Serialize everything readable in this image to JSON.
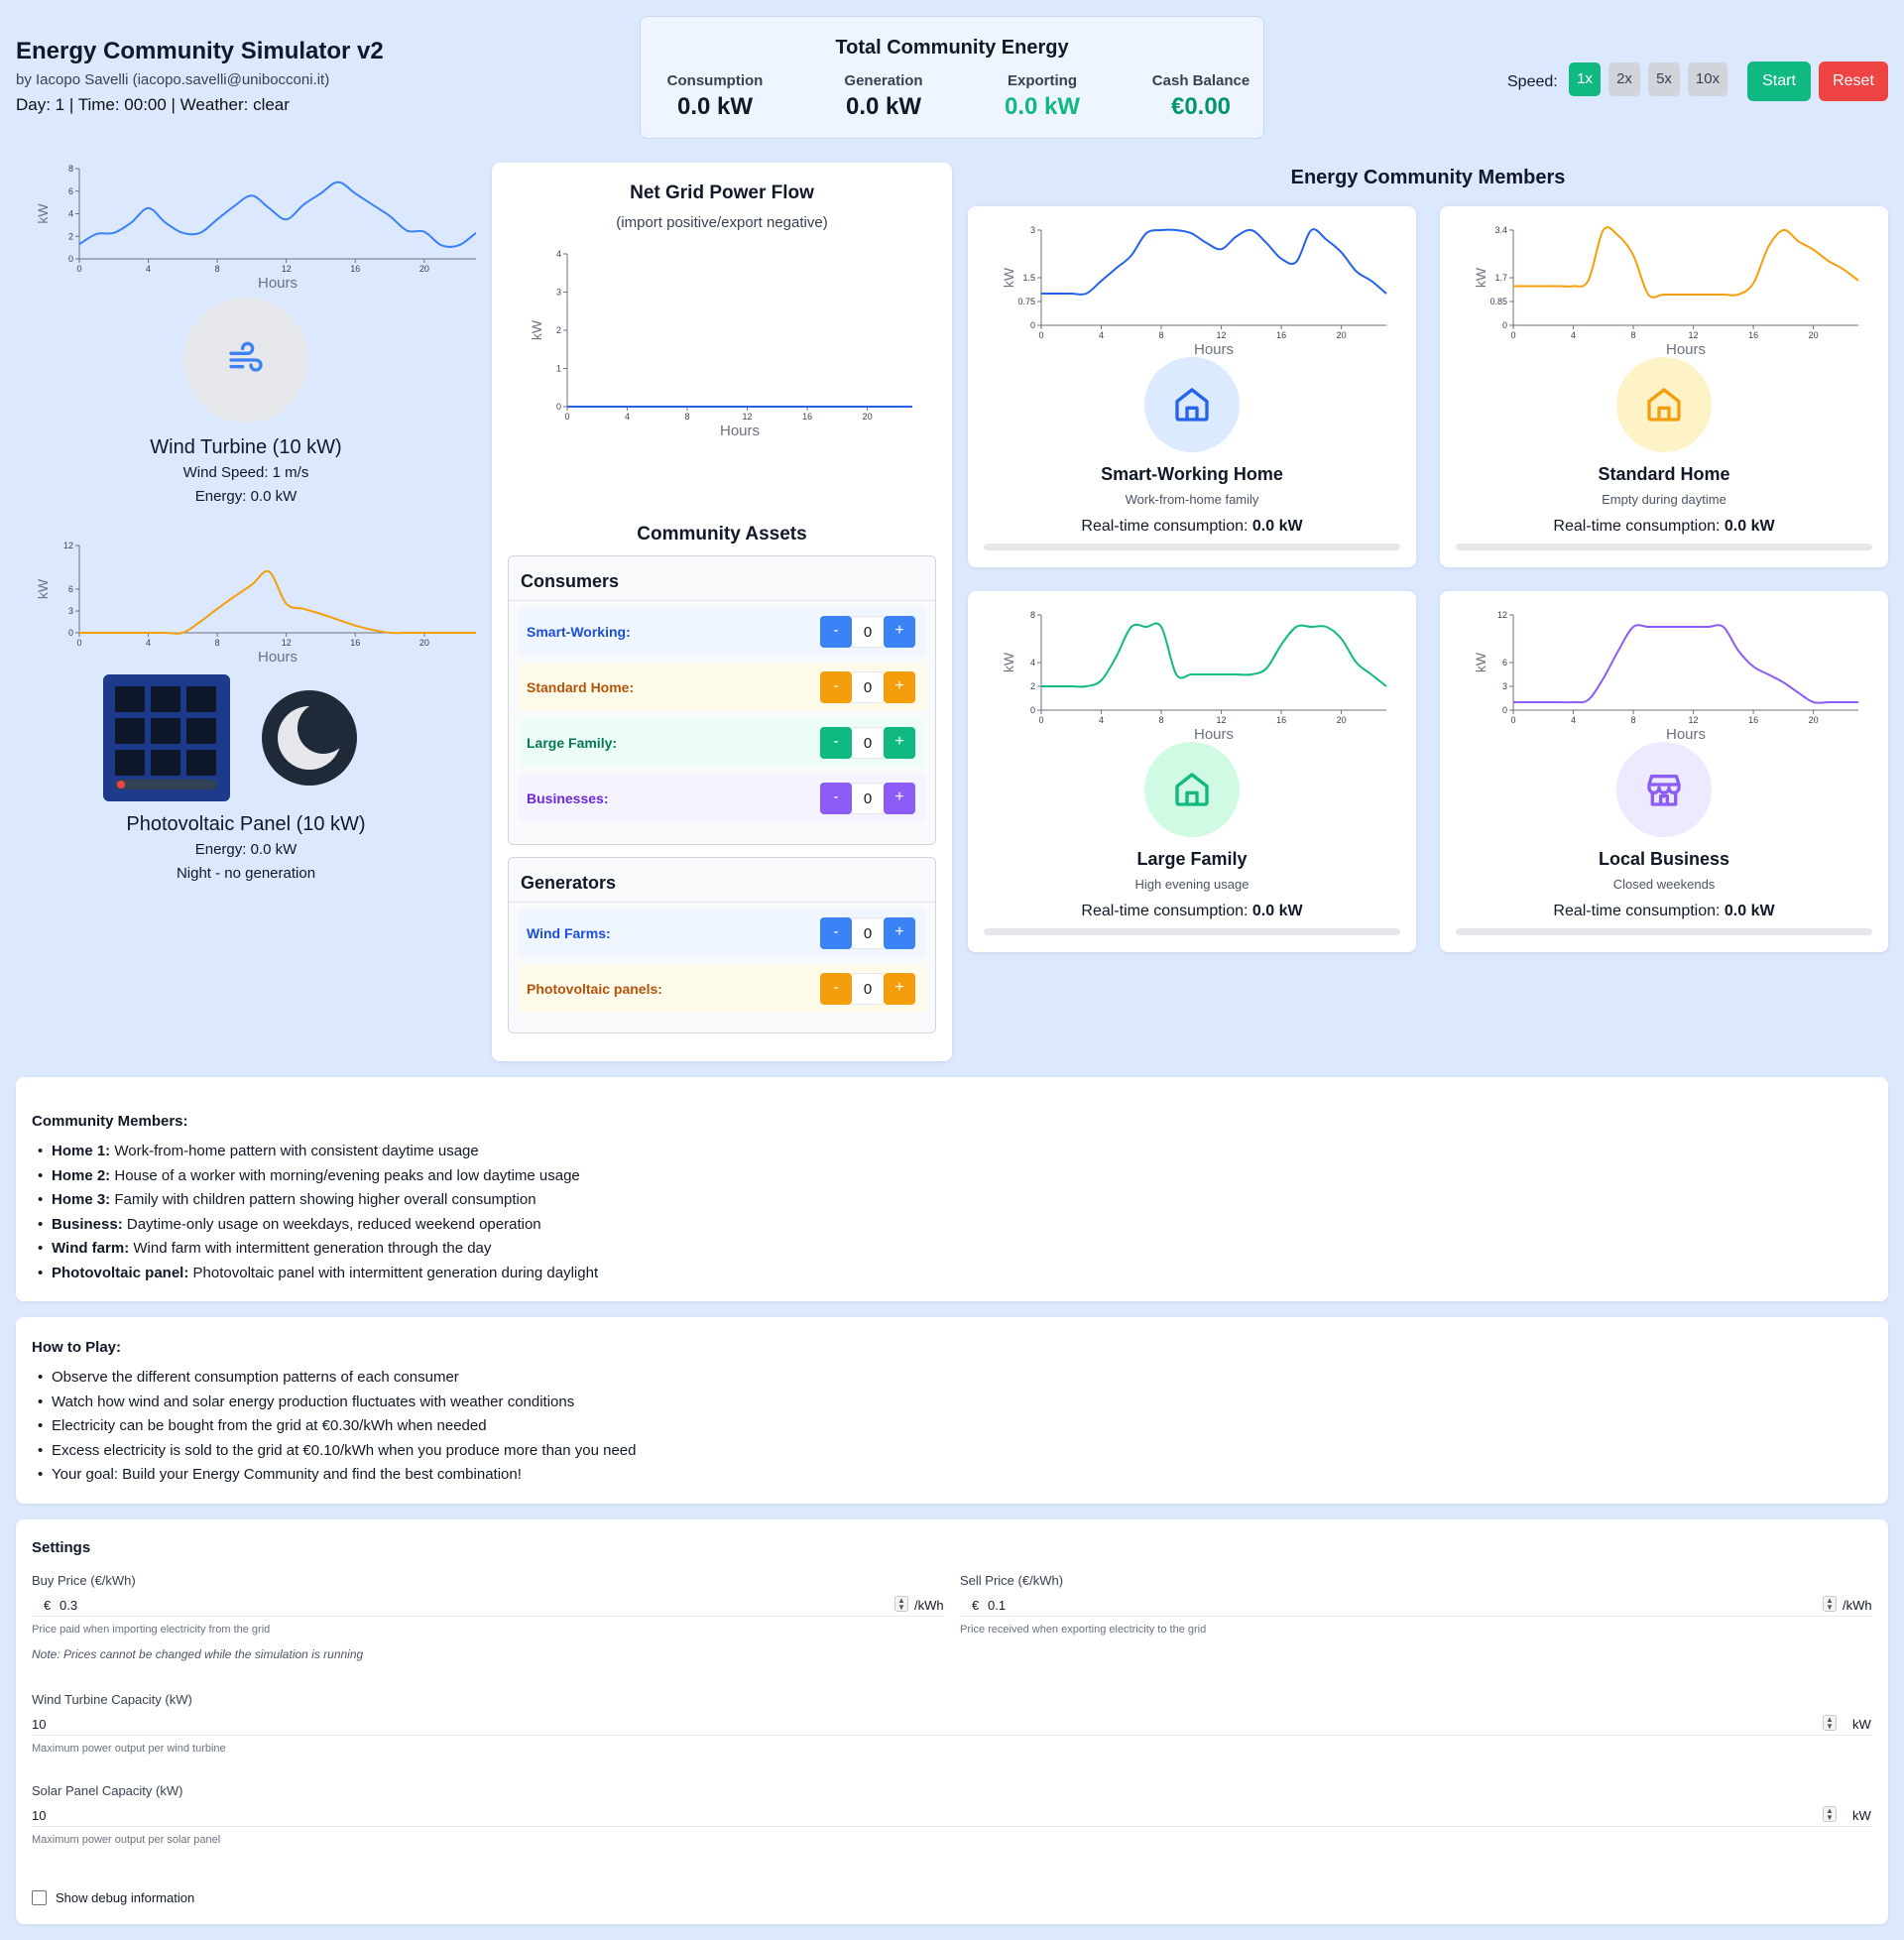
{
  "header": {
    "title": "Energy Community Simulator v2",
    "author": "by Iacopo Savelli (iacopo.savelli@unibocconi.it)",
    "status": "Day: 1 | Time: 00:00 | Weather: clear"
  },
  "totals": {
    "title": "Total Community Energy",
    "consumption_label": "Consumption",
    "consumption_value": "0.0 kW",
    "generation_label": "Generation",
    "generation_value": "0.0 kW",
    "exporting_label": "Exporting",
    "exporting_value": "0.0 kW",
    "cash_label": "Cash Balance",
    "cash_value": "€0.00"
  },
  "controls": {
    "speed_label": "Speed:",
    "speeds": [
      "1x",
      "2x",
      "5x",
      "10x"
    ],
    "active_speed": "1x",
    "start_label": "Start",
    "reset_label": "Reset"
  },
  "wind": {
    "title": "Wind Turbine (10 kW)",
    "speed": "Wind Speed: 1 m/s",
    "energy": "Energy: 0.0 kW",
    "icon": "wind-icon",
    "chart_data": {
      "type": "line",
      "ylabel": "kW",
      "xlabel": "Hours",
      "xlim": [
        0,
        23
      ],
      "ylim": [
        0,
        8
      ],
      "xticks": [
        0,
        4,
        8,
        12,
        16,
        20
      ],
      "yticks": [
        0,
        2,
        4,
        6,
        8
      ],
      "color": "#3b82f6",
      "x": [
        0,
        1,
        2,
        3,
        4,
        5,
        6,
        7,
        8,
        9,
        10,
        11,
        12,
        13,
        14,
        15,
        16,
        17,
        18,
        19,
        20,
        21,
        22,
        23
      ],
      "y": [
        1.3,
        2.2,
        2.3,
        3.2,
        4.5,
        3.2,
        2.3,
        2.3,
        3.5,
        4.7,
        5.6,
        4.5,
        3.5,
        4.8,
        5.8,
        6.8,
        5.8,
        4.8,
        3.8,
        2.5,
        2.4,
        1.2,
        1.2,
        2.3
      ]
    }
  },
  "solar": {
    "title": "Photovoltaic Panel (10 kW)",
    "energy": "Energy: 0.0 kW",
    "note": "Night - no generation",
    "icon": "moon-icon",
    "chart_data": {
      "type": "line",
      "ylabel": "kW",
      "xlabel": "Hours",
      "xlim": [
        0,
        23
      ],
      "ylim": [
        0,
        12
      ],
      "xticks": [
        0,
        4,
        8,
        12,
        16,
        20
      ],
      "yticks": [
        0,
        3,
        6,
        12
      ],
      "color": "#f59e0b",
      "x": [
        0,
        1,
        2,
        3,
        4,
        5,
        6,
        7,
        8,
        9,
        10,
        11,
        12,
        13,
        14,
        15,
        16,
        17,
        18,
        19,
        20,
        21,
        22,
        23
      ],
      "y": [
        0,
        0,
        0,
        0,
        0,
        0,
        0,
        1.5,
        3.3,
        5,
        6.6,
        8.4,
        4,
        3.3,
        2.6,
        1.8,
        1,
        0.4,
        0,
        0,
        0,
        0,
        0,
        0
      ]
    }
  },
  "grid": {
    "title": "Net Grid Power Flow",
    "subtitle": "(import positive/export negative)",
    "chart_data": {
      "type": "line",
      "ylabel": "kW",
      "xlabel": "Hours",
      "xlim": [
        0,
        23
      ],
      "ylim": [
        0,
        4
      ],
      "xticks": [
        0,
        4,
        8,
        12,
        16,
        20
      ],
      "yticks": [
        0,
        1,
        2,
        3,
        4
      ],
      "color": "#2563eb",
      "x": [
        0,
        23
      ],
      "y": [
        0,
        0
      ]
    }
  },
  "assets": {
    "title": "Community Assets",
    "consumers_title": "Consumers",
    "consumers": [
      {
        "label": "Smart-Working:",
        "count": "0",
        "color": "#3b82f6",
        "bg": "#eff6ff",
        "text": "#1d4ed8"
      },
      {
        "label": "Standard Home:",
        "count": "0",
        "color": "#f59e0b",
        "bg": "#fffbeb",
        "text": "#b45309"
      },
      {
        "label": "Large Family:",
        "count": "0",
        "color": "#10b981",
        "bg": "#ecfdf5",
        "text": "#047857"
      },
      {
        "label": "Businesses:",
        "count": "0",
        "color": "#8b5cf6",
        "bg": "#f5f3ff",
        "text": "#6d28d9"
      }
    ],
    "generators_title": "Generators",
    "generators": [
      {
        "label": "Wind Farms:",
        "count": "0",
        "color": "#3b82f6",
        "bg": "#eff6ff",
        "text": "#1d4ed8"
      },
      {
        "label": "Photovoltaic panels:",
        "count": "0",
        "color": "#f59e0b",
        "bg": "#fffbeb",
        "text": "#b45309"
      }
    ],
    "minus": "-",
    "plus": "+"
  },
  "members": {
    "title": "Energy Community Members",
    "rt_label": "Real-time consumption: ",
    "cards": [
      {
        "name": "Smart-Working Home",
        "desc": "Work-from-home family",
        "value": "0.0 kW",
        "color": "#2563eb",
        "circle": "#dbeafe",
        "icon": "home-icon",
        "chart_data": {
          "type": "line",
          "ylabel": "kW",
          "xlabel": "Hours",
          "xlim": [
            0,
            23
          ],
          "ylim": [
            0,
            3
          ],
          "xticks": [
            0,
            4,
            8,
            12,
            16,
            20
          ],
          "yticks": [
            0,
            0.75,
            1.5,
            3
          ],
          "x": [
            0,
            1,
            2,
            3,
            4,
            5,
            6,
            7,
            8,
            9,
            10,
            11,
            12,
            13,
            14,
            15,
            16,
            17,
            18,
            19,
            20,
            21,
            22,
            23
          ],
          "y": [
            1,
            1,
            1,
            1,
            1.4,
            1.8,
            2.2,
            2.9,
            3,
            3,
            2.9,
            2.6,
            2.4,
            2.8,
            3.0,
            2.6,
            2.1,
            2.0,
            3.0,
            2.7,
            2.3,
            1.7,
            1.4,
            1.0
          ]
        }
      },
      {
        "name": "Standard Home",
        "desc": "Empty during daytime",
        "value": "0.0 kW",
        "color": "#f59e0b",
        "circle": "#fef3c7",
        "icon": "home-icon",
        "chart_data": {
          "type": "line",
          "ylabel": "kW",
          "xlabel": "Hours",
          "xlim": [
            0,
            23
          ],
          "ylim": [
            0,
            3.4
          ],
          "xticks": [
            0,
            4,
            8,
            12,
            16,
            20
          ],
          "yticks": [
            0,
            0.85,
            1.7,
            3.4
          ],
          "x": [
            0,
            1,
            2,
            3,
            4,
            5,
            6,
            7,
            8,
            9,
            10,
            11,
            12,
            13,
            14,
            15,
            16,
            17,
            18,
            19,
            20,
            21,
            22,
            23
          ],
          "y": [
            1.4,
            1.4,
            1.4,
            1.4,
            1.4,
            1.6,
            3.4,
            3.2,
            2.5,
            1.1,
            1.1,
            1.1,
            1.1,
            1.1,
            1.1,
            1.1,
            1.5,
            2.8,
            3.4,
            3.0,
            2.7,
            2.3,
            2.0,
            1.6
          ]
        }
      },
      {
        "name": "Large Family",
        "desc": "High evening usage",
        "value": "0.0 kW",
        "color": "#10b981",
        "circle": "#d1fae5",
        "icon": "home-icon",
        "chart_data": {
          "type": "line",
          "ylabel": "kW",
          "xlabel": "Hours",
          "xlim": [
            0,
            23
          ],
          "ylim": [
            0,
            8
          ],
          "xticks": [
            0,
            4,
            8,
            12,
            16,
            20
          ],
          "yticks": [
            0,
            2,
            4,
            8
          ],
          "x": [
            0,
            1,
            2,
            3,
            4,
            5,
            6,
            7,
            8,
            9,
            10,
            11,
            12,
            13,
            14,
            15,
            16,
            17,
            18,
            19,
            20,
            21,
            22,
            23
          ],
          "y": [
            2,
            2,
            2,
            2,
            2.5,
            4.5,
            7,
            7,
            7,
            3,
            3,
            3,
            3,
            3,
            3,
            3.5,
            5.5,
            7,
            7,
            7,
            6,
            4,
            3,
            2
          ]
        }
      },
      {
        "name": "Local Business",
        "desc": "Closed weekends",
        "value": "0.0 kW",
        "color": "#8b5cf6",
        "circle": "#ede9fe",
        "icon": "store-icon",
        "chart_data": {
          "type": "line",
          "ylabel": "kW",
          "xlabel": "Hours",
          "xlim": [
            0,
            23
          ],
          "ylim": [
            0,
            12
          ],
          "xticks": [
            0,
            4,
            8,
            12,
            16,
            20
          ],
          "yticks": [
            0,
            3,
            6,
            12
          ],
          "x": [
            0,
            1,
            2,
            3,
            4,
            5,
            6,
            7,
            8,
            9,
            10,
            11,
            12,
            13,
            14,
            15,
            16,
            17,
            18,
            19,
            20,
            21,
            22,
            23
          ],
          "y": [
            1,
            1,
            1,
            1,
            1,
            1.3,
            4,
            7.5,
            10.5,
            10.5,
            10.5,
            10.5,
            10.5,
            10.5,
            10.5,
            7.5,
            5.5,
            4.5,
            3.5,
            2.2,
            1,
            1,
            1,
            1
          ]
        }
      }
    ]
  },
  "info_members": {
    "title": "Community Members:",
    "items": [
      {
        "b": "Home 1:",
        "t": " Work-from-home pattern with consistent daytime usage"
      },
      {
        "b": "Home 2:",
        "t": " House of a worker with morning/evening peaks and low daytime usage"
      },
      {
        "b": "Home 3:",
        "t": " Family with children pattern showing higher overall consumption"
      },
      {
        "b": "Business:",
        "t": " Daytime-only usage on weekdays, reduced weekend operation"
      },
      {
        "b": "Wind farm:",
        "t": " Wind farm with intermittent generation through the day"
      },
      {
        "b": "Photovoltaic panel:",
        "t": " Photovoltaic panel with intermittent generation during daylight"
      }
    ]
  },
  "howto": {
    "title": "How to Play:",
    "items": [
      "Observe the different consumption patterns of each consumer",
      "Watch how wind and solar energy production fluctuates with weather conditions",
      "Electricity can be bought from the grid at €0.30/kWh when needed",
      "Excess electricity is sold to the grid at €0.10/kWh when you produce more than you need",
      "Your goal: Build your Energy Community and find the best combination!"
    ]
  },
  "settings": {
    "title": "Settings",
    "buy_label": "Buy Price (€/kWh)",
    "buy_prefix": "€",
    "buy_value": "0.3",
    "buy_unit": "/kWh",
    "buy_hint": "Price paid when importing electricity from the grid",
    "buy_note": "Note: Prices cannot be changed while the simulation is running",
    "sell_label": "Sell Price (€/kWh)",
    "sell_prefix": "€",
    "sell_value": "0.1",
    "sell_unit": "/kWh",
    "sell_hint": "Price received when exporting electricity to the grid",
    "wind_label": "Wind Turbine Capacity (kW)",
    "wind_value": "10",
    "wind_unit": "kW",
    "wind_hint": "Maximum power output per wind turbine",
    "solar_label": "Solar Panel Capacity (kW)",
    "solar_value": "10",
    "solar_unit": "kW",
    "solar_hint": "Maximum power output per solar panel",
    "debug_label": "Show debug information"
  }
}
